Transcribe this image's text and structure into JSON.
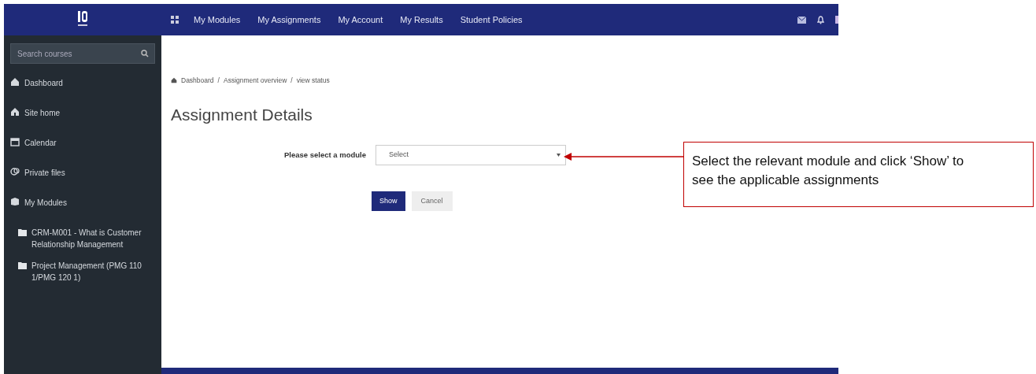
{
  "navbar": {
    "menu_items": [
      "My Modules",
      "My Assignments",
      "My Account",
      "My Results",
      "Student Policies"
    ]
  },
  "sidebar": {
    "search": {
      "placeholder": "Search courses"
    },
    "items": [
      {
        "label": "Dashboard",
        "kind": "link"
      },
      {
        "label": "Site home",
        "kind": "link"
      },
      {
        "label": "Calendar",
        "kind": "link"
      },
      {
        "label": "Private files",
        "kind": "link"
      },
      {
        "label": "My Modules",
        "kind": "link"
      },
      {
        "label": "CRM-M001 - What is Customer Relationship Management",
        "kind": "module"
      },
      {
        "label": "Project Management (PMG 110 1/PMG 120 1)",
        "kind": "module"
      }
    ]
  },
  "breadcrumb": [
    "Dashboard",
    "/",
    "Assignment overview",
    "/",
    "view status"
  ],
  "page_title": "Assignment Details",
  "form": {
    "label": "Please select a module",
    "select_value": "Select",
    "buttons": [
      {
        "label": "Show",
        "kind": "primary"
      },
      {
        "label": "Cancel",
        "kind": "secondary"
      }
    ]
  },
  "callout": {
    "text": "Select the relevant module and click ‘Show’ to see the applicable assignments"
  }
}
